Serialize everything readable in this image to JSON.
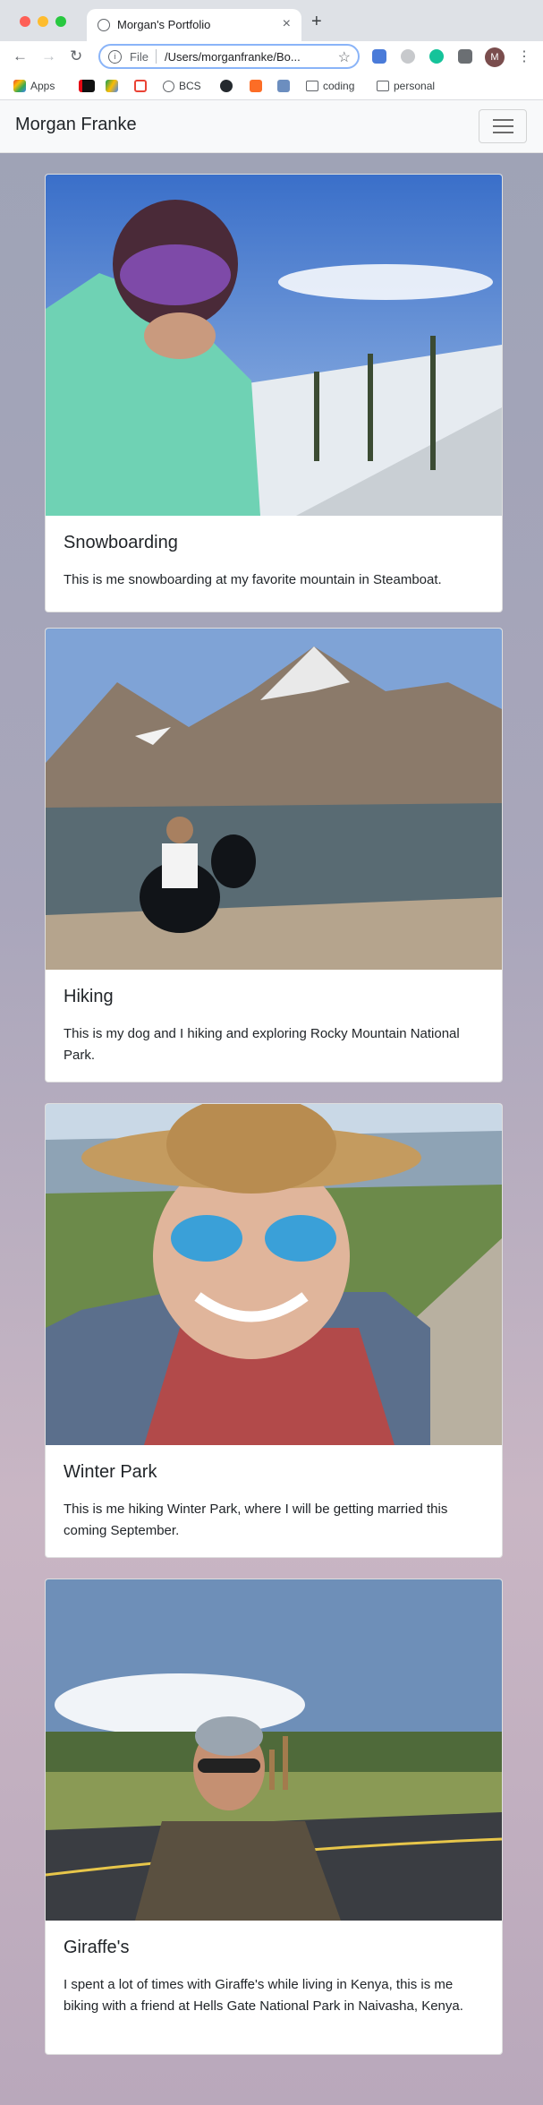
{
  "browser": {
    "tab_title": "Morgan's Portfolio",
    "tab_close": "×",
    "new_tab": "+",
    "url_scheme": "File",
    "url": "/Users/morganfranke/Bo...",
    "avatar_initial": "M",
    "bookmarks": [
      "Apps",
      "BCS",
      "coding",
      "personal"
    ]
  },
  "navbar": {
    "brand": "Morgan Franke"
  },
  "cards": [
    {
      "title": "Snowboarding",
      "text": "This is me snowboarding at my favorite mountain in Steamboat."
    },
    {
      "title": "Hiking",
      "text": "This is my dog and I hiking and exploring Rocky Mountain National Park."
    },
    {
      "title": "Winter Park",
      "text": "This is me hiking Winter Park, where I will be getting married this coming September."
    },
    {
      "title": "Giraffe's",
      "text": "I spent a lot of times with Giraffe's while living in Kenya, this is me biking with a friend at Hells Gate National Park in Naivasha, Kenya."
    }
  ]
}
